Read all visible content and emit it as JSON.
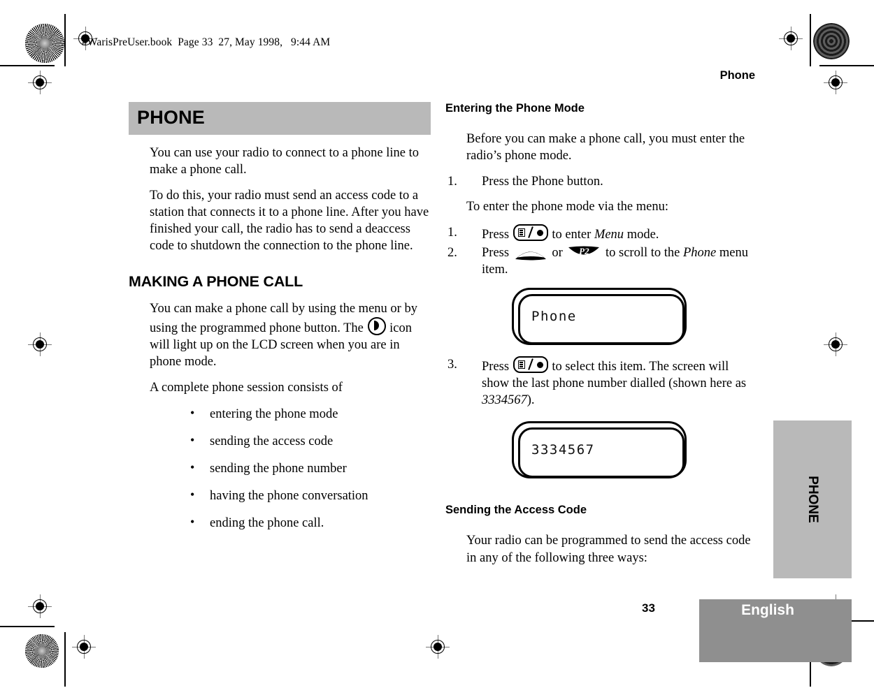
{
  "document": {
    "slug": "#WarisPreUser.book  Page 33  27, May 1998,   9:44 AM",
    "running_head": "Phone",
    "page_number": "33",
    "language_tab": "English",
    "side_tab": "PHONE"
  },
  "left_column": {
    "banner_title": "PHONE",
    "intro_paragraph_1": "You can use your radio to connect to a phone line to make a phone call.",
    "intro_paragraph_2": "To do this, your radio must send an access code to a station that connects it to a phone line. After you have finished your call, the radio has to send a deaccess code to shutdown the connection to the phone line.",
    "section_heading": "MAKING A PHONE CALL",
    "making_call_text_before_icon": "You can make a phone call by using the menu or by using the programmed phone button. The ",
    "making_call_text_after_icon": " icon will light up on the LCD screen when you are in phone mode.",
    "session_intro": "A complete phone session consists of",
    "bullet_marker": "•",
    "bullets": [
      "entering the phone mode",
      "sending the access code",
      "sending the phone number",
      "having the phone conversation",
      "ending the phone call."
    ]
  },
  "right_column": {
    "heading_entering": "Entering the Phone Mode",
    "entering_intro": "Before you can make a phone call, you must enter the radio’s phone mode.",
    "step_phone_button_num": "1.",
    "step_phone_button": "Press the Phone button.",
    "menu_intro": "To enter the phone mode via the menu:",
    "step1_num": "1.",
    "step1_pre": "Press ",
    "step1_mid": " to enter ",
    "step1_em": "Menu",
    "step1_post": " mode.",
    "step2_num": "2.",
    "step2_pre": "Press ",
    "step2_or": " or ",
    "step2_post": " to scroll to the ",
    "step2_em": "Phone",
    "step2_end": " menu item.",
    "step3_num": "3.",
    "step3_pre": "Press ",
    "step3_post": " to select this item. The screen will show the last phone number dialled (shown here as ",
    "step3_em": "3334567",
    "step3_end": ").",
    "lcd_phone_text": "Phone",
    "lcd_number_text": "3334567",
    "heading_sending": "Sending the Access Code",
    "sending_intro": "Your radio can be programmed to send the access code in any of the following three ways:"
  },
  "icons": {
    "menu_button": "menu-select-button-icon",
    "dome_button": "dome-scroll-button-icon",
    "p2_button_label": "P2",
    "phone_indicator": "phone-indicator-icon"
  },
  "colors": {
    "banner_gray": "#b9b9b9",
    "footer_gray": "#8f8f8f",
    "text_black": "#000000"
  }
}
